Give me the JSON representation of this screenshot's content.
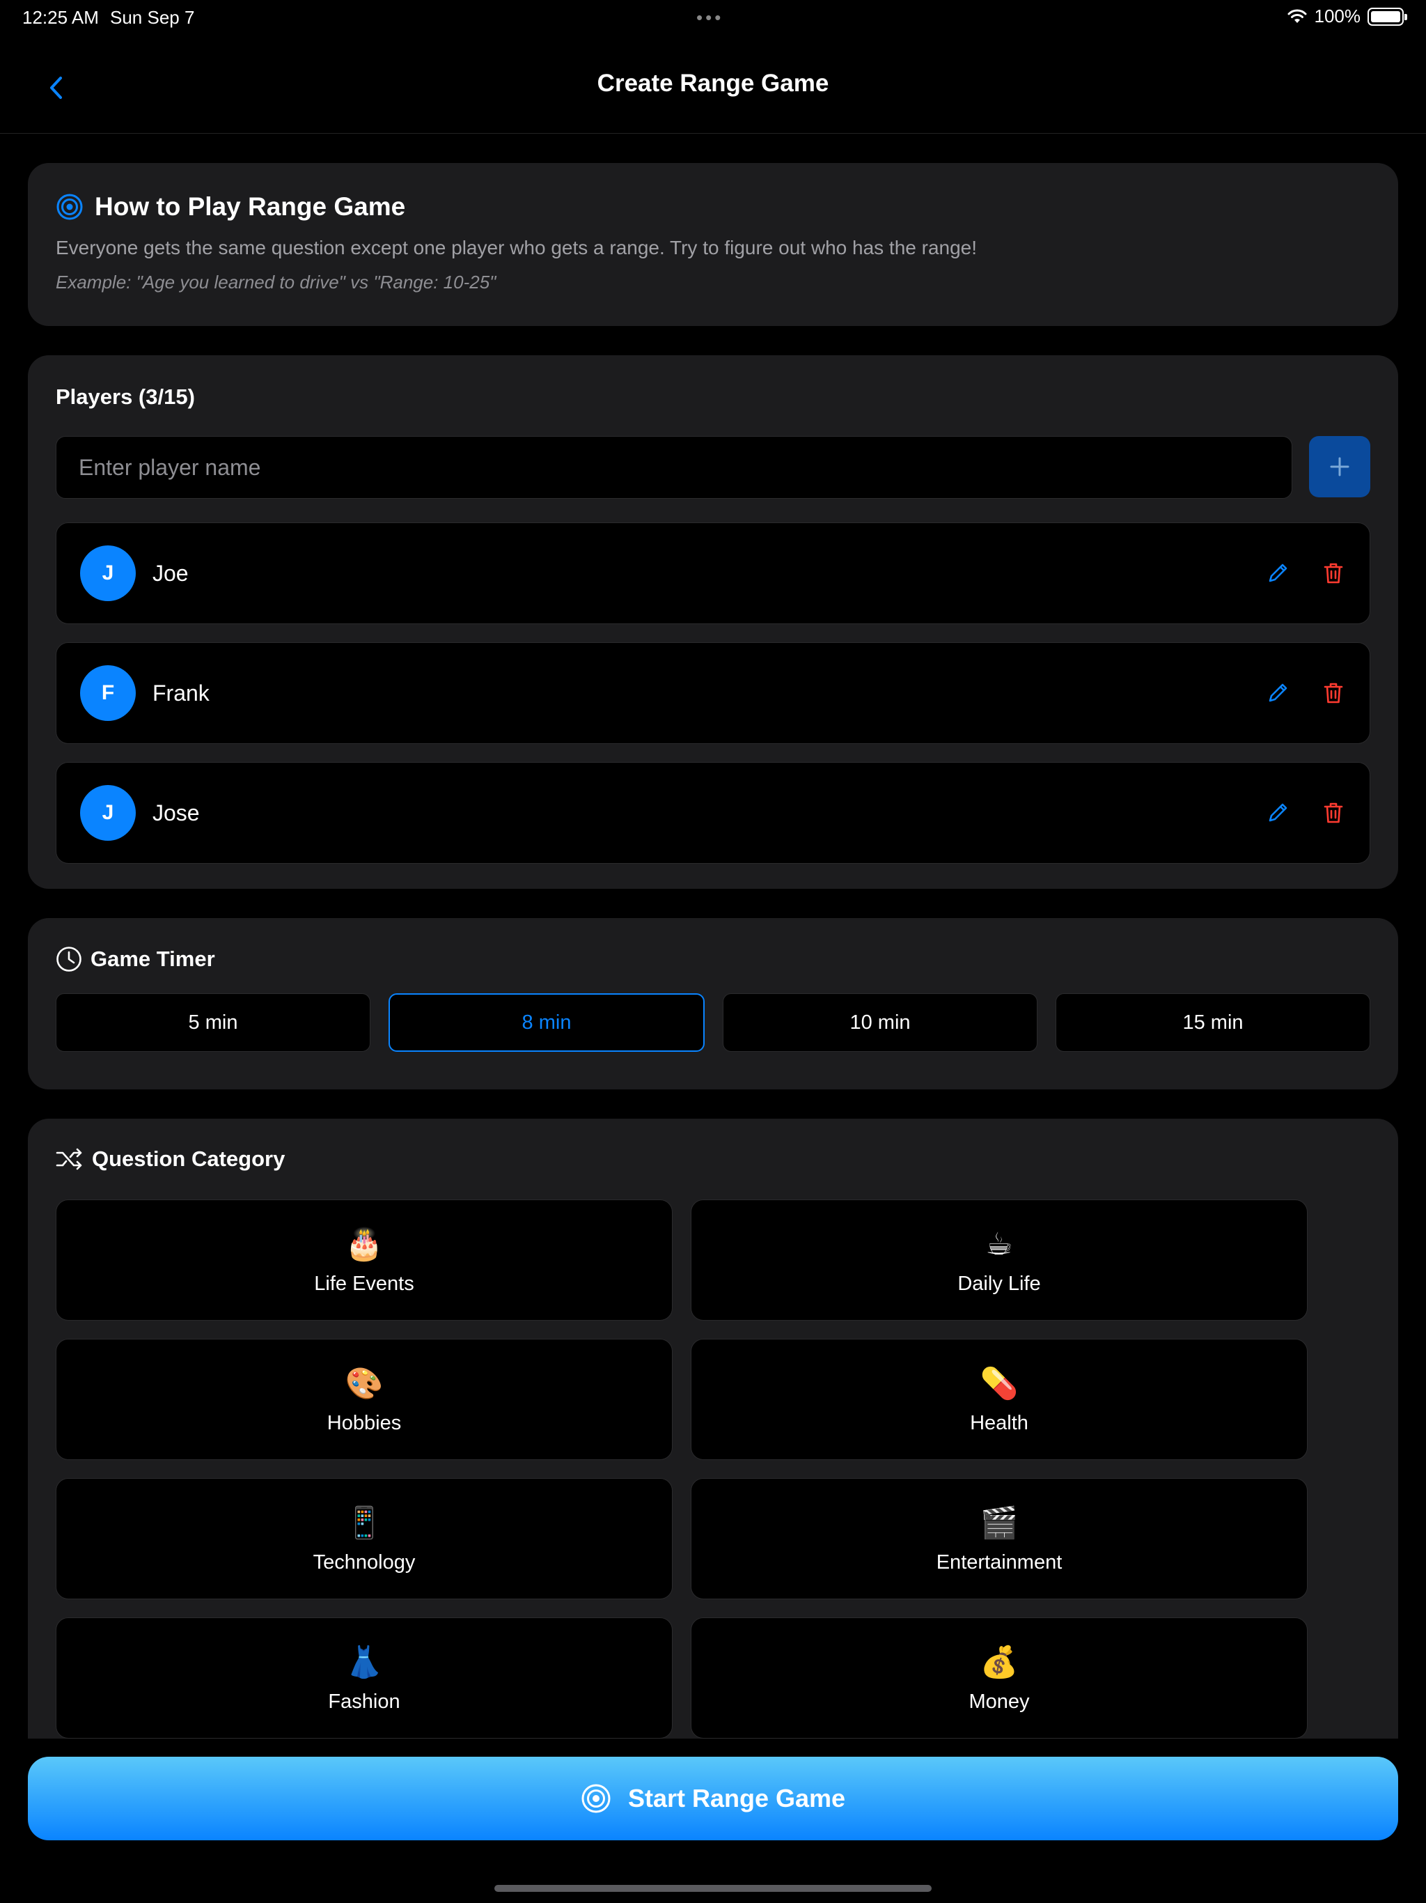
{
  "status_bar": {
    "time": "12:25 AM",
    "date": "Sun Sep 7",
    "battery": "100%"
  },
  "nav": {
    "title": "Create Range Game"
  },
  "how_to": {
    "title": "How to Play Range Game",
    "description": "Everyone gets the same question except one player who gets a range. Try to figure out who has the range!",
    "example": "Example: \"Age you learned to drive\" vs \"Range: 10-25\""
  },
  "players": {
    "title": "Players (3/15)",
    "input_placeholder": "Enter player name",
    "list": [
      {
        "initial": "J",
        "name": "Joe"
      },
      {
        "initial": "F",
        "name": "Frank"
      },
      {
        "initial": "J",
        "name": "Jose"
      }
    ]
  },
  "timer": {
    "title": "Game Timer",
    "options": [
      "5 min",
      "8 min",
      "10 min",
      "15 min"
    ],
    "selected": "8 min"
  },
  "categories": {
    "title": "Question Category",
    "items": [
      {
        "emoji": "🎂",
        "label": "Life Events"
      },
      {
        "emoji": "☕",
        "label": "Daily Life"
      },
      {
        "emoji": "🎨",
        "label": "Hobbies"
      },
      {
        "emoji": "💊",
        "label": "Health"
      },
      {
        "emoji": "📱",
        "label": "Technology"
      },
      {
        "emoji": "🎬",
        "label": "Entertainment"
      },
      {
        "emoji": "👗",
        "label": "Fashion"
      },
      {
        "emoji": "💰",
        "label": "Money"
      }
    ]
  },
  "start_button": {
    "label": "Start Range Game"
  },
  "colors": {
    "accent": "#0a84ff",
    "danger": "#ff3b30",
    "card": "#1c1c1e"
  }
}
